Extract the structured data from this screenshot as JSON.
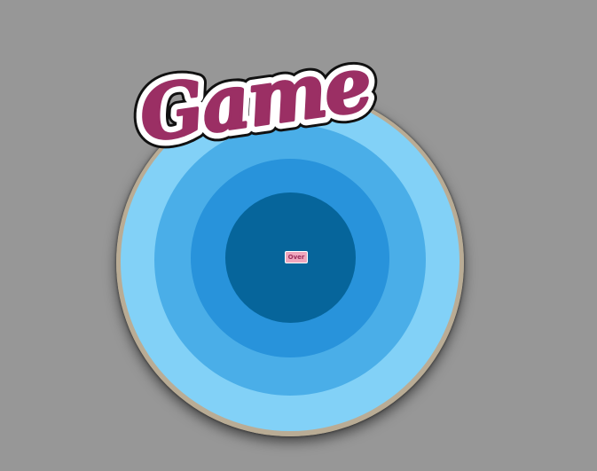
{
  "title": {
    "text": "Game"
  },
  "center": {
    "label": "Over"
  },
  "colors": {
    "background": "#979797",
    "ring_outer": "#82d1f7",
    "ring_second": "#4aaee8",
    "ring_third": "#2893db",
    "ring_inner": "#06659b",
    "title_fill": "#9b2f64",
    "title_outline_inner": "#ffffff",
    "title_outline_outer": "#111111"
  }
}
